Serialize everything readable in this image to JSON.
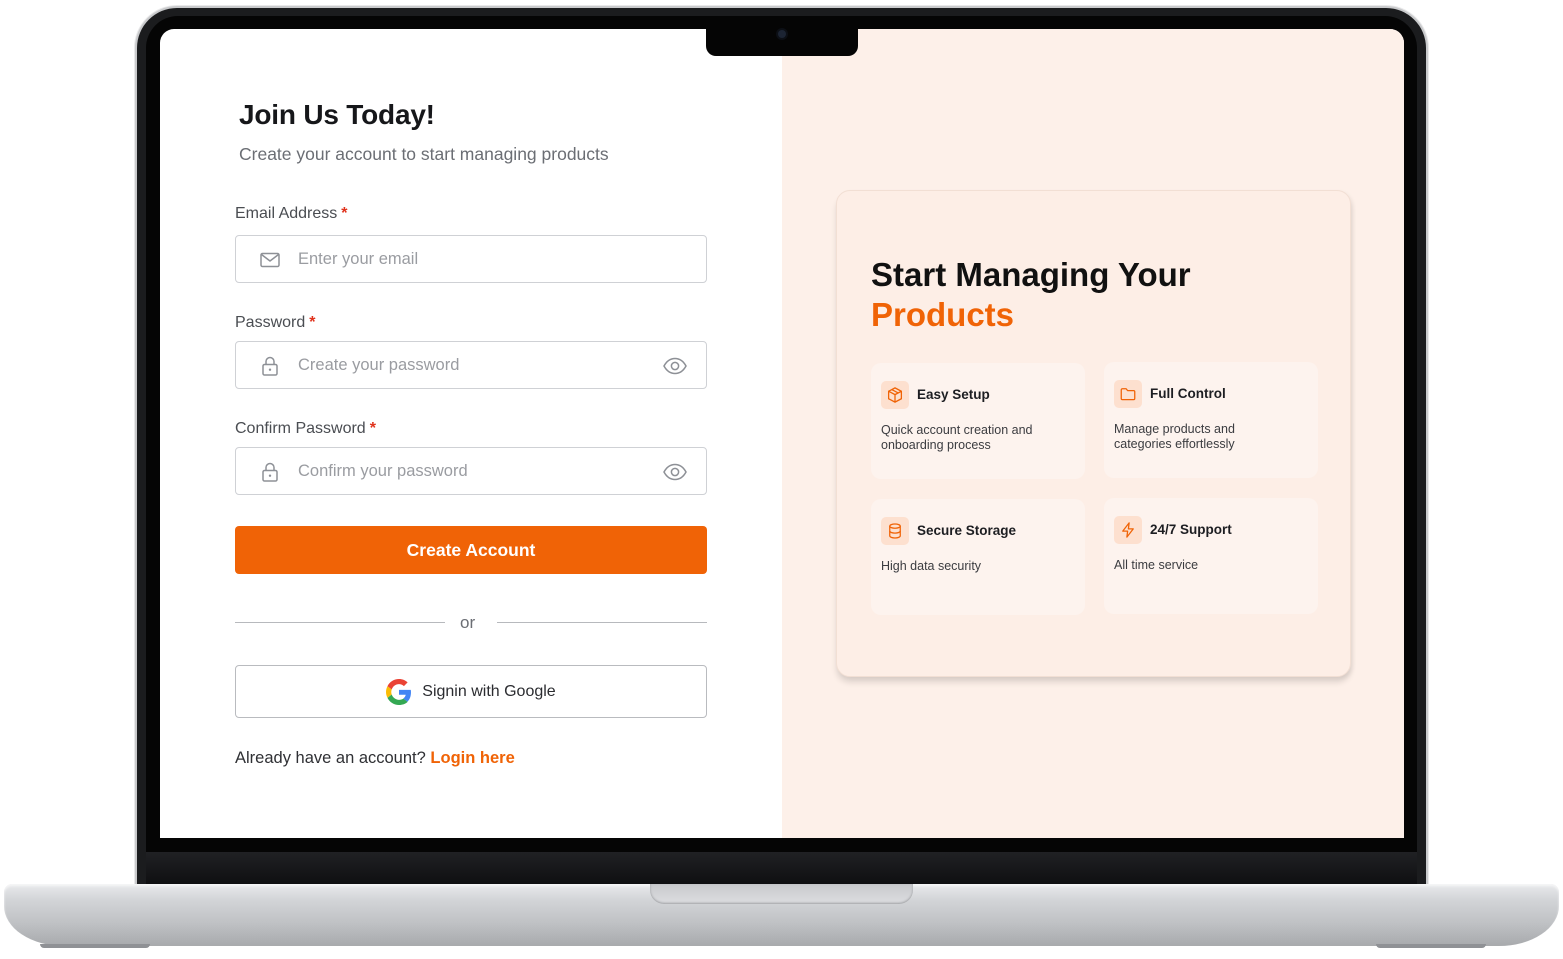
{
  "signup": {
    "title": "Join Us Today!",
    "subtitle": "Create your account to start managing products",
    "email": {
      "label": "Email Address",
      "required_mark": "*",
      "placeholder": "Enter your email",
      "value": ""
    },
    "password": {
      "label": "Password",
      "required_mark": "*",
      "placeholder": "Create your password",
      "value": ""
    },
    "confirm": {
      "label": "Confirm Password",
      "required_mark": "*",
      "placeholder": "Confirm your password",
      "value": ""
    },
    "submit_label": "Create Account",
    "divider_text": "or",
    "google_label": "Signin with Google",
    "footer_prompt": "Already have an account?",
    "footer_link": "Login here"
  },
  "promo": {
    "title_line1": "Start Managing Your",
    "title_line2": "Products",
    "features": [
      {
        "icon": "package-icon",
        "title": "Easy Setup",
        "desc": "Quick account creation and onboarding process"
      },
      {
        "icon": "folder-icon",
        "title": "Full Control",
        "desc": "Manage products and categories effortlessly"
      },
      {
        "icon": "database-icon",
        "title": "Secure Storage",
        "desc": "High data security"
      },
      {
        "icon": "lightning-icon",
        "title": "24/7 Support",
        "desc": "All time service"
      }
    ]
  },
  "colors": {
    "accent": "#f06306",
    "promo_background": "#fdf0e9",
    "card_background": "#fdeee6",
    "required": "#e0321c"
  }
}
